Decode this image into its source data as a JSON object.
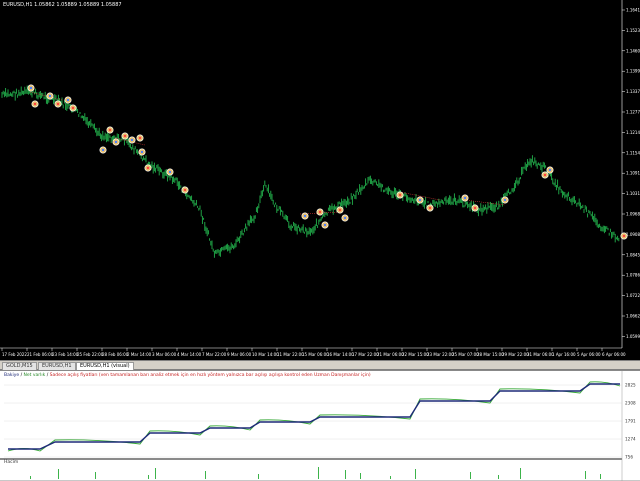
{
  "chart": {
    "symbol_line": "EURUSD,H1  1.05862 1.05889 1.05889 1.05887",
    "price_ticks": [
      "1.16410",
      "1.15230",
      "1.14605",
      "1.13990",
      "1.13375",
      "1.12770",
      "1.12145",
      "1.11540",
      "1.10915",
      "1.10310",
      "1.09685",
      "1.09080",
      "1.08455",
      "1.07860",
      "1.07225",
      "1.06620",
      "1.05995"
    ],
    "time_ticks": [
      "17 Feb 2022",
      "21 Feb 06:00",
      "23 Feb 14:00",
      "25 Feb 22:00",
      "28 Feb 06:00",
      "2 Mar 14:00",
      "3 Mar 06:00",
      "4 Mar 14:00",
      "7 Mar 22:00",
      "9 Mar 06:00",
      "10 Mar 14:00",
      "11 Mar 22:00",
      "15 Mar 06:00",
      "16 Mar 14:00",
      "17 Mar 22:00",
      "21 Mar 06:00",
      "22 Mar 15:00",
      "23 Mar 22:00",
      "25 Mar 07:00",
      "28 Mar 15:00",
      "29 Mar 22:00",
      "31 Mar 06:00",
      "1 Apr 16:00",
      "5 Apr 06:00",
      "6 Apr 06:00"
    ],
    "colors": {
      "candle": "#22b14c",
      "background": "#000000",
      "axis": "#ffffff",
      "marker_fill": "#e8c070",
      "marker_buy": "#4a7fff",
      "marker_sell": "#ff4040"
    }
  },
  "tabs": [
    {
      "label": "GOLD,M15",
      "active": false
    },
    {
      "label": "EURUSD,H1",
      "active": false
    },
    {
      "label": "EURUSD,H1 (visual)",
      "active": true
    }
  ],
  "tester": {
    "legend": {
      "balance": "Bakiye",
      "equity": "Net varlık",
      "note": "Sadece açılış fiyatları (ven tamamlanan barı analiz etmek için en hızlı yöntem yalnızca bar açılışı açılışa kontrol eden Uzman Danışmanlar için)"
    },
    "balance_ticks": [
      "2825",
      "2308",
      "1791",
      "1274",
      "756"
    ],
    "volume_label": "Hacim",
    "colors": {
      "balance": "#1e2a78",
      "equity": "#36a836",
      "volume": "#3cb34a",
      "grid": "#d8d8d8"
    }
  }
}
